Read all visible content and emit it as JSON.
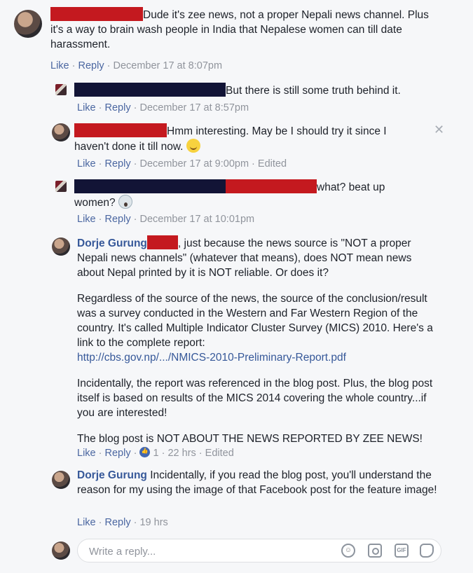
{
  "comments": [
    {
      "text": "Dude it's zee news, not a proper Nepali news channel. Plus it's a way to brain wash people in India that Nepalese women can till date harassment.",
      "meta": {
        "like": "Like",
        "reply": "Reply",
        "time": "December 17 at 8:07pm"
      }
    },
    {
      "text": "But there is still some truth behind it.",
      "meta": {
        "like": "Like",
        "reply": "Reply",
        "time": "December 17 at 8:57pm"
      }
    },
    {
      "text": "Hmm interesting. May be I should try it since I haven't done it till now.",
      "meta": {
        "like": "Like",
        "reply": "Reply",
        "time": "December 17 at 9:00pm",
        "edited": "Edited"
      }
    },
    {
      "text_a": "what? beat up",
      "text_b": "women?",
      "meta": {
        "like": "Like",
        "reply": "Reply",
        "time": "December 17 at 10:01pm"
      }
    },
    {
      "author": "Dorje Gurung",
      "p1": ", just because the news source is \"NOT a proper Nepali news channels\" (whatever that means), does NOT mean news about Nepal printed by it is NOT reliable. Or does it?",
      "p2": "Regardless of the source of the news, the source of the conclusion/result was a survey conducted in the Western and Far Western Region of the country. It's called Multiple Indicator Cluster Survey (MICS) 2010. Here's a link to the complete report:",
      "link": "http://cbs.gov.np/.../NMICS-2010-Preliminary-Report.pdf",
      "p3": "Incidentally, the report was referenced in the blog post. Plus, the blog post itself is based on results of the MICS 2014 covering the whole country...if you are interested!",
      "p4": "The blog post is NOT ABOUT THE NEWS REPORTED BY ZEE NEWS!",
      "meta": {
        "like": "Like",
        "reply": "Reply",
        "reactions": "1",
        "time": "22 hrs",
        "edited": "Edited"
      }
    },
    {
      "author": "Dorje Gurung",
      "text": "Incidentally, if you read the blog post, you'll understand the reason for my using the image of that Facebook post for the feature image!",
      "meta": {
        "like": "Like",
        "reply": "Reply",
        "time": "19 hrs"
      }
    }
  ],
  "reply": {
    "placeholder": "Write a reply...",
    "tools": {
      "gif": "GIF"
    }
  },
  "icons": [
    "close-icon",
    "smile-emoji-icon",
    "scream-emoji-icon",
    "like-reaction-icon",
    "emoji-icon",
    "camera-icon",
    "gif-icon",
    "sticker-icon"
  ],
  "colors": {
    "link": "#365899",
    "meta": "#90949c",
    "action": "#4b67a1",
    "redact_red": "#c4191f",
    "redact_navy": "#121436"
  }
}
